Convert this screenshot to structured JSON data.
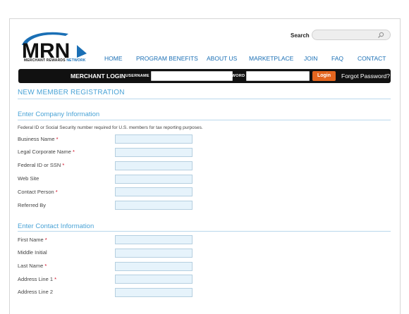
{
  "brand": {
    "logo_letters": "MRN",
    "tagline_part1": "MERCHANT REWARDS",
    "tagline_part2": "NETWORK",
    "accent_color": "#1a6fb5",
    "dark_color": "#111111"
  },
  "search": {
    "label": "Search",
    "placeholder": "",
    "icon": "search-icon"
  },
  "nav": {
    "items": [
      {
        "label": "HOME"
      },
      {
        "label": "PROGRAM BENEFITS"
      },
      {
        "label": "ABOUT US"
      },
      {
        "label": "MARKETPLACE"
      },
      {
        "label": "JOIN"
      },
      {
        "label": "FAQ"
      },
      {
        "label": "CONTACT"
      }
    ]
  },
  "login_bar": {
    "title": "MERCHANT LOGIN",
    "username_label": "USERNAME",
    "username_value": "",
    "password_label": "PASSWORD",
    "password_value": "",
    "login_button": "Login",
    "login_button_color": "#e4661f",
    "forgot_link": "Forgot Password?"
  },
  "page": {
    "title": "NEW MEMBER REGISTRATION"
  },
  "company_section": {
    "title": "Enter Company Information",
    "note": "Federal ID or Social Security number required for U.S. members for tax reporting purposes.",
    "fields": [
      {
        "label": "Business Name",
        "required": "*",
        "value": ""
      },
      {
        "label": "Legal Corporate Name",
        "required": "*",
        "value": ""
      },
      {
        "label": "Federal ID or SSN",
        "required": "*",
        "value": ""
      },
      {
        "label": "Web Site",
        "required": "",
        "value": ""
      },
      {
        "label": "Contact Person",
        "required": "*",
        "value": ""
      },
      {
        "label": "Referred By",
        "required": "",
        "value": ""
      }
    ]
  },
  "contact_section": {
    "title": "Enter Contact Information",
    "fields": [
      {
        "label": "First Name",
        "required": "*",
        "value": ""
      },
      {
        "label": "Middle Initial",
        "required": "",
        "value": ""
      },
      {
        "label": "Last Name",
        "required": "*",
        "value": ""
      },
      {
        "label": "Address Line 1",
        "required": "*",
        "value": ""
      },
      {
        "label": "Address Line 2",
        "required": "",
        "value": ""
      }
    ]
  }
}
